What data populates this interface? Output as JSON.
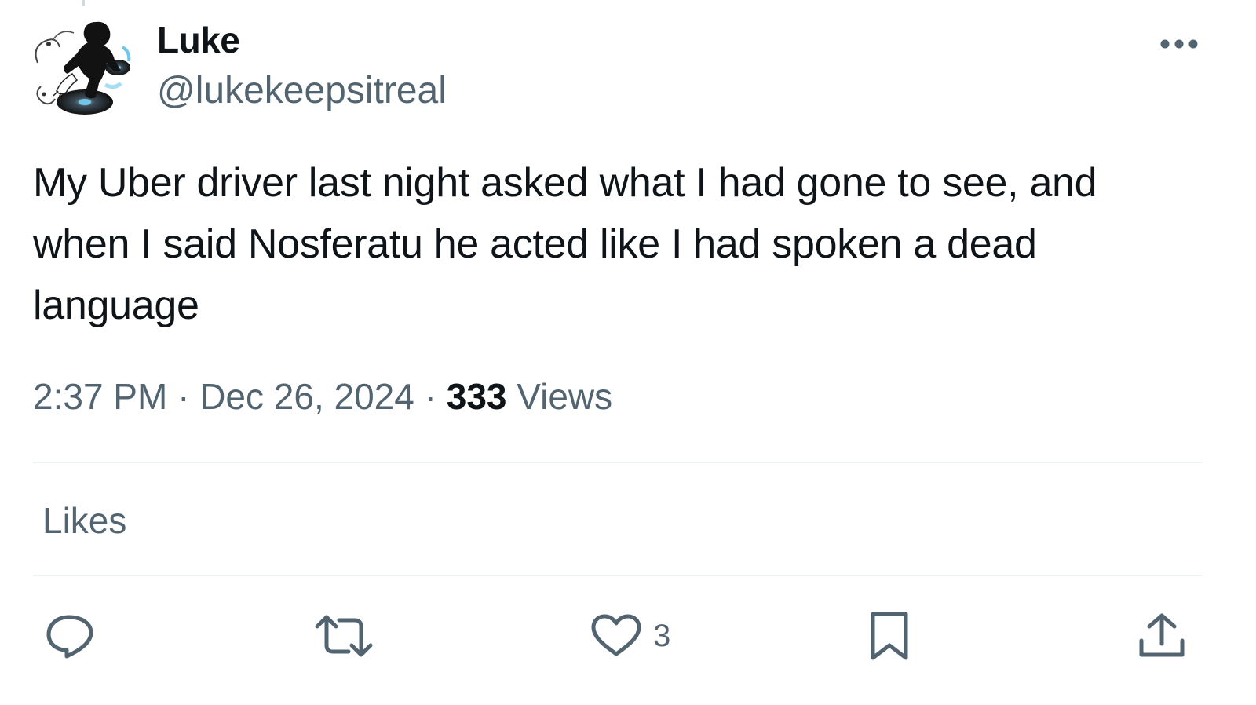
{
  "author": {
    "display_name": "Luke",
    "handle": "@lukekeepsitreal",
    "avatar_icon": "dj-turntable-avatar"
  },
  "tweet": {
    "text": "My Uber driver last night asked what I had gone to see, and when I said Nosferatu he acted like I had spoken a dead language"
  },
  "meta": {
    "time": "2:37 PM",
    "separator": "·",
    "date": "Dec 26, 2024",
    "views_count": "333",
    "views_label": "Views"
  },
  "likes_tab_label": "Likes",
  "actions": {
    "reply_icon": "reply-icon",
    "retweet_icon": "retweet-icon",
    "like_icon": "heart-icon",
    "like_count": "3",
    "bookmark_icon": "bookmark-icon",
    "share_icon": "share-icon"
  },
  "colors": {
    "text_primary": "#0f1419",
    "text_secondary": "#536471",
    "divider": "#eff3f4"
  }
}
